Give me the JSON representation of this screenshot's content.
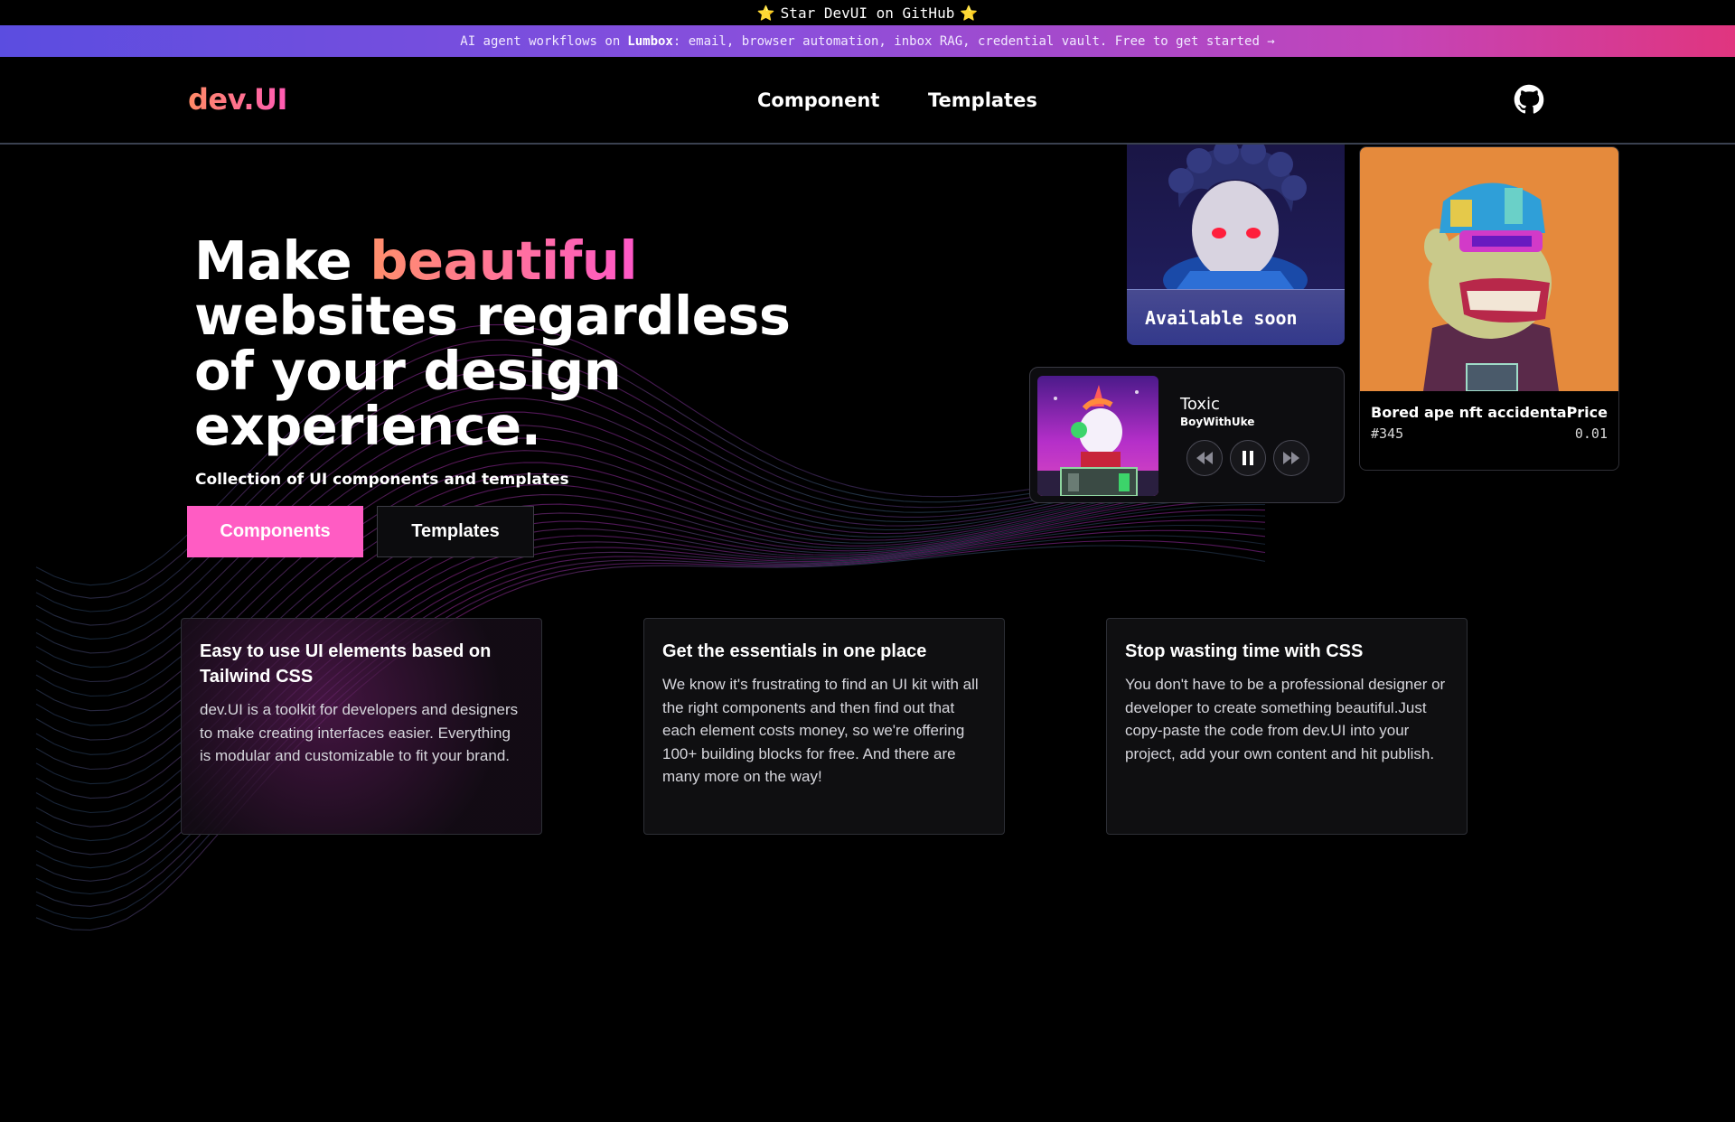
{
  "announcement": {
    "text": "Star DevUI on GitHub",
    "star_glyph": "⭐"
  },
  "promo": {
    "prefix": "AI agent workflows on",
    "brand": "Lumbox",
    "suffix": ": email, browser automation, inbox RAG, credential vault. Free to get started →"
  },
  "header": {
    "logo": "dev.UI",
    "nav": [
      "Component",
      "Templates"
    ],
    "github_icon": "github-icon"
  },
  "hero": {
    "title_prefix": "Make ",
    "title_accent": "beautiful",
    "title_rest": "websites regardless of your design experience.",
    "subtitle": "Collection of UI components and templates",
    "primary_button": "Components",
    "secondary_button": "Templates"
  },
  "features": [
    {
      "title": "Easy to use UI elements based on Tailwind CSS",
      "body": "dev.UI is a toolkit for developers and designers to make creating interfaces easier. Everything is modular and customizable to fit your brand."
    },
    {
      "title": "Get the essentials in one place",
      "body": "We know it's frustrating to find an UI kit with all the right components and then find out that each element costs money, so we're offering 100+ building blocks for free. And there are many more on the way!"
    },
    {
      "title": "Stop wasting time with CSS",
      "body": "You don't have to be a professional designer or developer to create something beautiful.Just copy-paste the code from dev.UI into your project, add your own content and hit publish."
    }
  ],
  "showcase": {
    "available_card": {
      "label": "Available soon"
    },
    "player": {
      "title": "Toxic",
      "artist": "BoyWithUke",
      "controls": [
        "rewind-icon",
        "pause-icon",
        "fast-forward-icon"
      ]
    },
    "nft": {
      "name": "Bored ape nft accidental",
      "id": "#345",
      "price_label": "Price",
      "price": "0.01"
    }
  },
  "colors": {
    "accent_pink": "#ff5cc3",
    "accent_orange": "#ff8f6b",
    "nft_bg": "#e58a3c"
  }
}
